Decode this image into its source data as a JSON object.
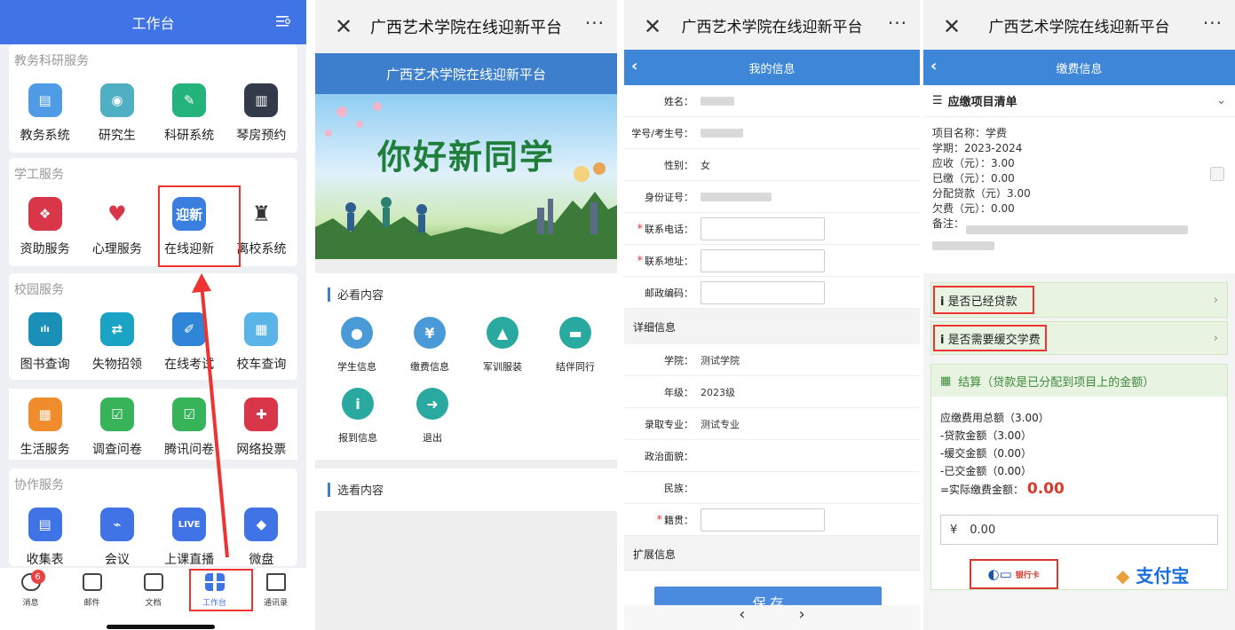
{
  "panel1": {
    "title": "工作台",
    "sections": [
      {
        "title": "教务科研服务",
        "apps": [
          {
            "label": "教务系统",
            "icon": "textbook-icon",
            "color": "#4f9be6",
            "glyph": "▤"
          },
          {
            "label": "研究生",
            "icon": "graduate-icon",
            "color": "#4fb0c4",
            "glyph": "◉"
          },
          {
            "label": "科研系统",
            "icon": "edit-icon",
            "color": "#24b37a",
            "glyph": "✎"
          },
          {
            "label": "琴房预约",
            "icon": "piano-icon",
            "color": "#333a4a",
            "glyph": "▥"
          }
        ]
      },
      {
        "title": "学工服务",
        "apps": [
          {
            "label": "资助服务",
            "icon": "aid-icon",
            "color": "#d9364a",
            "glyph": "❖"
          },
          {
            "label": "心理服务",
            "icon": "heart-icon",
            "color": "#ffffff",
            "glyph": "♥"
          },
          {
            "label": "在线迎新",
            "icon": "welcome-icon",
            "color": "#3a7fe0",
            "glyph": "迎新"
          },
          {
            "label": "离校系统",
            "icon": "graduation-cap-icon",
            "color": "#ffffff",
            "glyph": "♜"
          }
        ]
      },
      {
        "title": "校园服务",
        "apps": [
          {
            "label": "图书查询",
            "icon": "books-icon",
            "color": "#1a8fb8",
            "glyph": "ılı"
          },
          {
            "label": "失物招领",
            "icon": "lost-found-icon",
            "color": "#1aa3c4",
            "glyph": "⇄"
          },
          {
            "label": "在线考试",
            "icon": "pen-icon",
            "color": "#2f86d8",
            "glyph": "✐"
          },
          {
            "label": "校车查询",
            "icon": "bus-icon",
            "color": "#5bb4e8",
            "glyph": "▦"
          }
        ]
      },
      {
        "title": "",
        "apps": [
          {
            "label": "生活服务",
            "icon": "shop-icon",
            "color": "#f08c2b",
            "glyph": "▦"
          },
          {
            "label": "调查问卷",
            "icon": "survey-icon",
            "color": "#37b35a",
            "glyph": "☑"
          },
          {
            "label": "腾讯问卷",
            "icon": "survey-icon",
            "color": "#37b35a",
            "glyph": "☑"
          },
          {
            "label": "网络投票",
            "icon": "vote-icon",
            "color": "#d9364a",
            "glyph": "✚"
          }
        ]
      },
      {
        "title": "协作服务",
        "apps": [
          {
            "label": "收集表",
            "icon": "form-icon",
            "color": "#3f73e6",
            "glyph": "▤"
          },
          {
            "label": "会议",
            "icon": "meeting-icon",
            "color": "#3f73e6",
            "glyph": "⌁"
          },
          {
            "label": "上课直播",
            "icon": "live-icon",
            "color": "#3f73e6",
            "glyph": "LIVE"
          },
          {
            "label": "微盘",
            "icon": "disk-icon",
            "color": "#3f73e6",
            "glyph": "◆"
          }
        ]
      }
    ],
    "tabs": [
      {
        "label": "消息",
        "badge": "6"
      },
      {
        "label": "邮件"
      },
      {
        "label": "文档"
      },
      {
        "label": "工作台"
      },
      {
        "label": "通讯录"
      }
    ]
  },
  "panel2": {
    "wx_title": "广西艺术学院在线迎新平台",
    "subtitle": "广西艺术学院在线迎新平台",
    "banner_text": "你好新同学",
    "must_read": "必看内容",
    "optional": "选看内容",
    "items": [
      {
        "label": "学生信息",
        "icon": "user-icon",
        "color": "#4b9ad8",
        "glyph": "●"
      },
      {
        "label": "缴费信息",
        "icon": "yen-icon",
        "color": "#4b9ad8",
        "glyph": "¥"
      },
      {
        "label": "军训服装",
        "icon": "cap-icon",
        "color": "#2aa9a0",
        "glyph": "▲"
      },
      {
        "label": "结伴同行",
        "icon": "car-icon",
        "color": "#2aa9a0",
        "glyph": "▬"
      },
      {
        "label": "报到信息",
        "icon": "info-icon",
        "color": "#2aa9a0",
        "glyph": "i"
      },
      {
        "label": "退出",
        "icon": "exit-icon",
        "color": "#2aa9a0",
        "glyph": "➜"
      }
    ]
  },
  "panel3": {
    "wx_title": "广西艺术学院在线迎新平台",
    "page_title": "我的信息",
    "fields": [
      {
        "label": "姓名：",
        "value": "",
        "blur": 38
      },
      {
        "label": "学号/考生号：",
        "value": "",
        "blur": 48
      },
      {
        "label": "性别：",
        "value": "女"
      },
      {
        "label": "身份证号：",
        "value": "",
        "blur": 80
      },
      {
        "label": "联系电话：",
        "input": true,
        "required": true
      },
      {
        "label": "联系地址：",
        "input": true,
        "required": true
      },
      {
        "label": "邮政编码：",
        "input": true
      }
    ],
    "detail_head": "详细信息",
    "detail_fields": [
      {
        "label": "学院：",
        "value": "测试学院"
      },
      {
        "label": "年级：",
        "value": "2023级"
      },
      {
        "label": "录取专业：",
        "value": "测试专业"
      },
      {
        "label": "政治面貌：",
        "value": ""
      },
      {
        "label": "民族：",
        "value": ""
      },
      {
        "label": "籍贯：",
        "input": true,
        "required": true
      }
    ],
    "ext_head": "扩展信息",
    "save": "保 存"
  },
  "panel4": {
    "wx_title": "广西艺术学院在线迎新平台",
    "page_title": "缴费信息",
    "list_title": "应缴项目清单",
    "item_lines": [
      "项目名称：学费",
      "学期：2023-2024",
      "应收（元）：3.00",
      "已缴（元）：0.00",
      "分配贷款（元）3.00",
      "欠费（元）：0.00",
      "备注："
    ],
    "loan_q": "是否已经贷款",
    "defer_q": "是否需要缓交学费",
    "settle_title": "结算（贷款是已分配到项目上的金额）",
    "settle_lines": [
      "应缴费用总额（3.00）",
      "-贷款金额（3.00）",
      "-缓交金额（0.00）",
      "-已交金额（0.00）"
    ],
    "actual_label": "=实际缴费金额：",
    "actual_amount": "0.00",
    "pay_currency": "¥",
    "pay_value": "0.00",
    "unionpay": "银行卡",
    "alipay": "支付宝"
  }
}
